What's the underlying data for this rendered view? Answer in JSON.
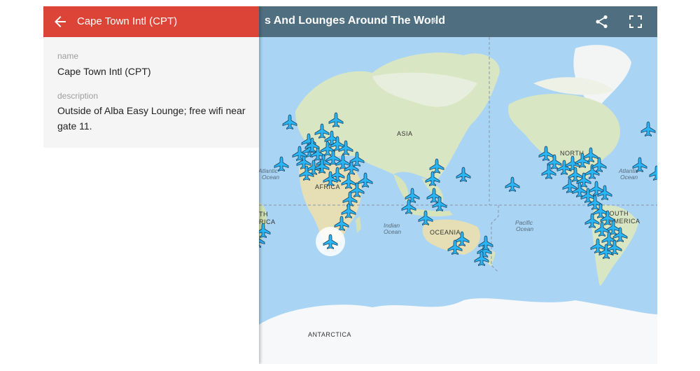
{
  "map": {
    "title": "s And Lounges Around The World",
    "labels": {
      "asia": "ASIA",
      "africa": "AFRICA",
      "oceania": "OCEANIA",
      "antarctica": "ANTARCTICA",
      "north_america": "NORTH",
      "south_america": "SOUTH",
      "south_america_2": "AMERICA",
      "atlantic": "Atlantic",
      "atlantic_ocean": "Ocean",
      "indian": "Indian",
      "indian_ocean": "Ocean",
      "pacific": "Pacific",
      "pacific_ocean": "Ocean",
      "atlantic_right": "Atlantic",
      "atlantic_right_ocean": "Ocean",
      "left_edge_1": "TH",
      "left_edge_2": "RICA"
    },
    "icons": {
      "star": "star-icon",
      "share": "share-icon",
      "fullscreen": "fullscreen-icon",
      "marker": "airplane-marker-icon"
    }
  },
  "panel": {
    "title": "Cape Town Intl (CPT)",
    "name_label": "name",
    "name_value": "Cape Town Intl (CPT)",
    "description_label": "description",
    "description_value": "Outside of Alba Easy Lounge; free wifi near gate 11.",
    "back_icon": "arrow-back-icon"
  },
  "colors": {
    "panel_header": "#db4437",
    "map_header": "#4f6f80",
    "marker": "#29b6f6",
    "ocean": "#a9d4f4"
  }
}
